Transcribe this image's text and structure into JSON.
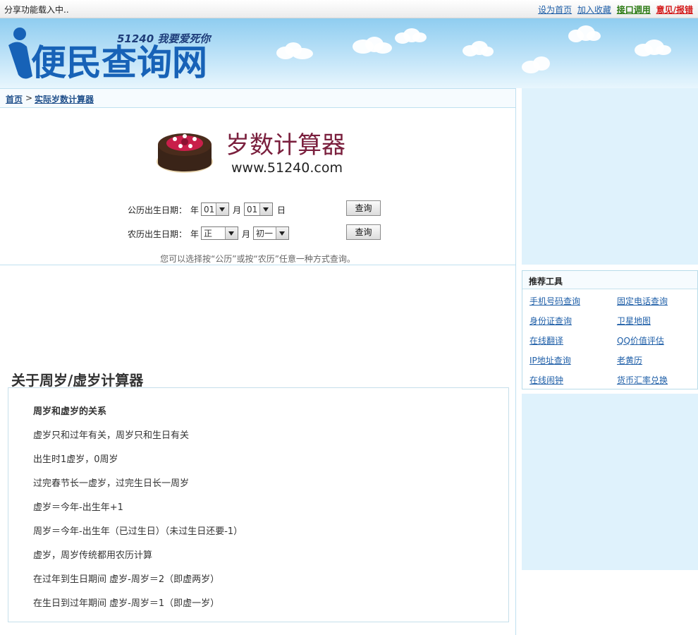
{
  "topbar": {
    "share_text": "分享功能载入中..",
    "links": [
      "设为首页",
      "加入收藏",
      "接口调用",
      "意见/报错"
    ]
  },
  "header": {
    "logo_main": "便民查询网",
    "logo_slogan": "51240 我要爱死你"
  },
  "breadcrumb": {
    "home": "首页",
    "separator": ">",
    "current": "实际岁数计算器"
  },
  "calculator": {
    "brand_title": "岁数计算器",
    "brand_url": "www.51240.com",
    "solar": {
      "label": "公历出生日期：",
      "year_unit": "年",
      "month_value": "01",
      "month_unit": "月",
      "day_value": "01",
      "day_unit": "日",
      "button": "查询"
    },
    "lunar": {
      "label": "农历出生日期：",
      "year_unit": "年",
      "month_value": "正",
      "month_unit": "月",
      "day_value": "初一",
      "button": "查询"
    },
    "hint": "您可以选择按“公历”或按“农历”任意一种方式查询。"
  },
  "about": {
    "heading": "关于周岁/虚岁计算器",
    "lines": [
      "周岁和虚岁的关系",
      "虚岁只和过年有关，周岁只和生日有关",
      "出生时1虚岁，0周岁",
      "过完春节长一虚岁，过完生日长一周岁",
      "虚岁＝今年-出生年+1",
      "周岁＝今年-出生年（已过生日）（未过生日还要-1）",
      "虚岁，周岁传统都用农历计算",
      "在过年到生日期间 虚岁-周岁＝2（即虚两岁）",
      "在生日到过年期间 虚岁-周岁＝1（即虚一岁）"
    ]
  },
  "sidebar": {
    "tools_title": "推荐工具",
    "tools": [
      "手机号码查询",
      "固定电话查询",
      "身份证查询",
      "卫星地图",
      "在线翻译",
      "QQ价值评估",
      "IP地址查询",
      "老黄历",
      "在线闹钟",
      "货币汇率兑换"
    ]
  },
  "colors": {
    "link": "#1f5fa8",
    "green_link": "#2a7a12",
    "red_link": "#d41717",
    "sky": "#bfe3f8",
    "ad_bg": "#dff2fc"
  }
}
